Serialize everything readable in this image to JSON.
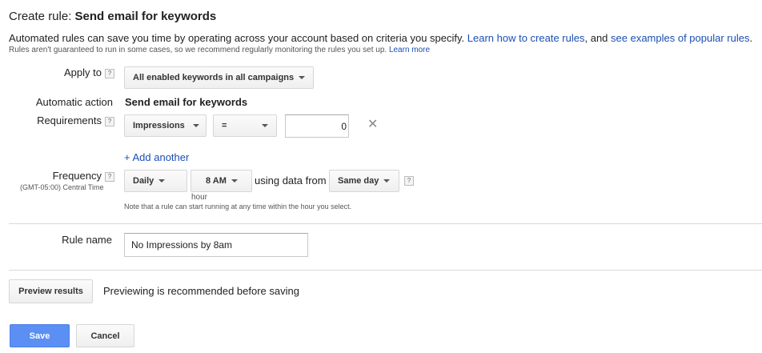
{
  "header": {
    "title_prefix": "Create rule: ",
    "title_name": "Send email for keywords"
  },
  "description": {
    "text": "Automated rules can save you time by operating across your account based on criteria you specify. ",
    "link1": "Learn how to create rules",
    "middle": ", and ",
    "link2": "see examples of popular rules",
    "end": "."
  },
  "notice": {
    "text": "Rules aren't guaranteed to run in some cases, so we recommend regularly monitoring the rules you set up. ",
    "link": "Learn more"
  },
  "apply_to": {
    "label": "Apply to",
    "help": "?",
    "value": "All enabled keywords in all campaigns"
  },
  "automatic_action": {
    "label": "Automatic action",
    "value": "Send email for keywords"
  },
  "requirements": {
    "label": "Requirements",
    "help": "?",
    "metric": "Impressions",
    "operator": "=",
    "value": "0",
    "remove": "✕",
    "add_another": "+ Add another"
  },
  "frequency": {
    "label": "Frequency",
    "help": "?",
    "timezone": "(GMT-05:00) Central Time",
    "period": "Daily",
    "time": "8 AM",
    "time_sublabel": "hour",
    "using_text": "using data from",
    "data_range": "Same day",
    "data_help": "?",
    "note": "Note that a rule can start running at any time within the hour you select."
  },
  "rule_name": {
    "label": "Rule name",
    "value": "No Impressions by 8am"
  },
  "preview": {
    "button": "Preview results",
    "text": "Previewing is recommended before saving"
  },
  "actions": {
    "save": "Save",
    "cancel": "Cancel"
  }
}
